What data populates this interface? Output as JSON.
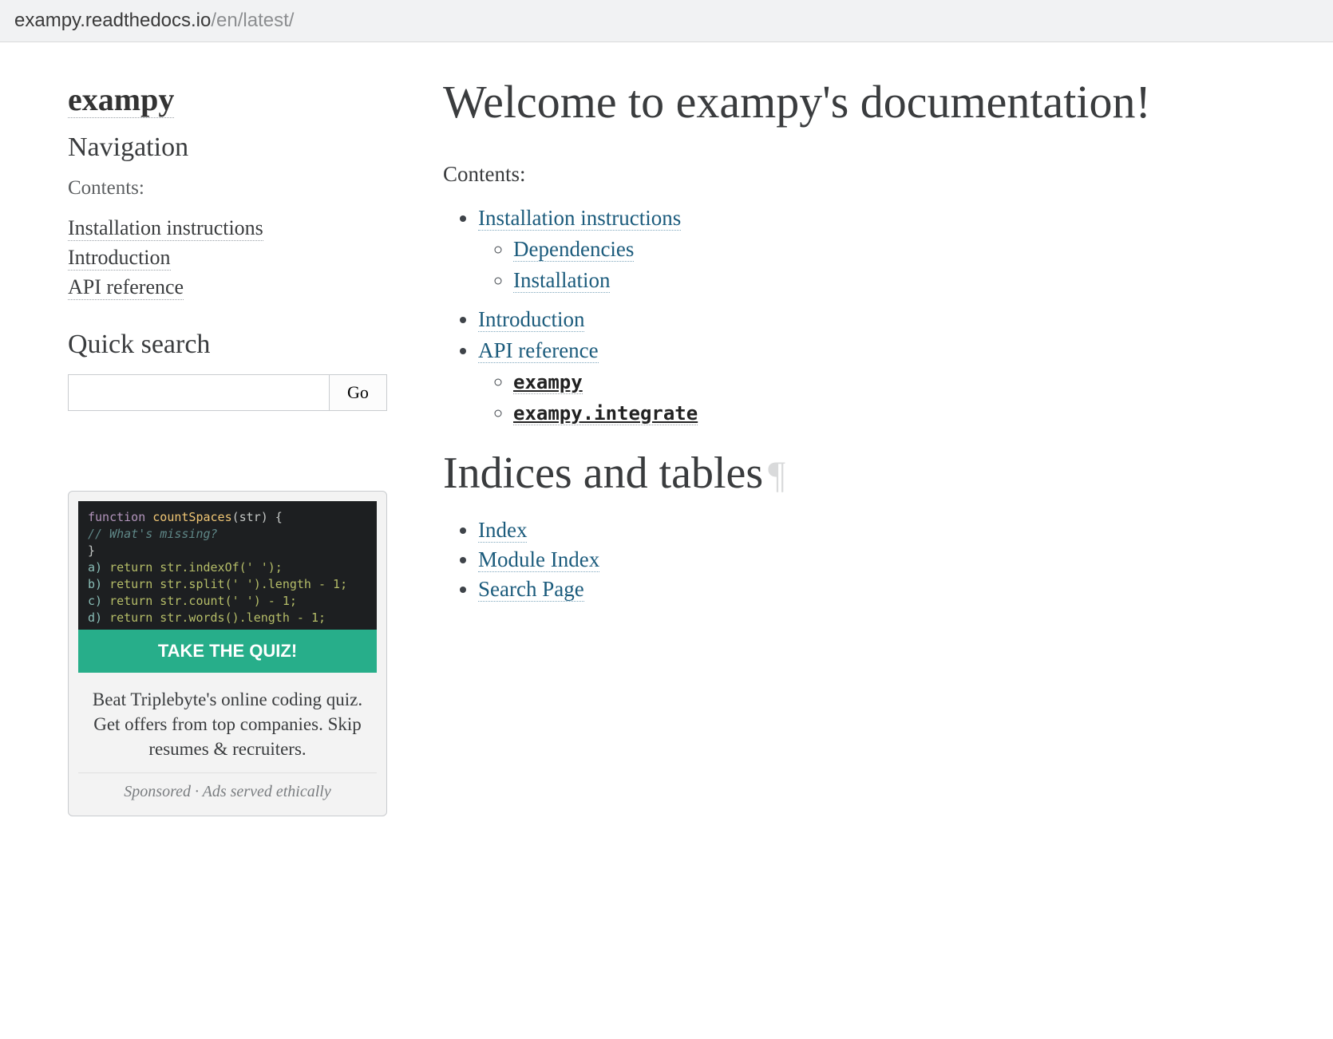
{
  "url": {
    "host": "exampy.readthedocs.io",
    "path": "/en/latest/"
  },
  "sidebar": {
    "site_title": "exampy",
    "nav_heading": "Navigation",
    "contents_label": "Contents:",
    "nav": [
      "Installation instructions",
      "Introduction",
      "API reference"
    ],
    "search_heading": "Quick search",
    "search_placeholder": "",
    "search_button": "Go"
  },
  "ad": {
    "code_lines": {
      "l1_kw": "function",
      "l1_fn": " countSpaces",
      "l1_rest": "(str) {",
      "l2": "  // What's missing?",
      "l3": "}",
      "opt_a": "a) ",
      "opt_a_code": "return str.indexOf(' ');",
      "opt_b": "b) ",
      "opt_b_code": "return str.split(' ').length - 1;",
      "opt_c": "c) ",
      "opt_c_code": "return str.count(' ') - 1;",
      "opt_d": "d) ",
      "opt_d_code": "return str.words().length - 1;"
    },
    "cta": "TAKE THE QUIZ!",
    "text": "Beat Triplebyte's online coding quiz. Get offers from top companies. Skip resumes & recruiters.",
    "footer": "Sponsored · Ads served ethically"
  },
  "main": {
    "title": "Welcome to exampy's documentation!",
    "contents_label": "Contents:",
    "toc": [
      {
        "label": "Installation instructions",
        "children": [
          {
            "label": "Dependencies"
          },
          {
            "label": "Installation"
          }
        ]
      },
      {
        "label": "Introduction"
      },
      {
        "label": "API reference",
        "children": [
          {
            "label": "exampy",
            "code": true
          },
          {
            "label": "exampy.integrate",
            "code": true
          }
        ]
      }
    ],
    "indices_heading": "Indices and tables",
    "pilcrow": "¶",
    "indices": [
      "Index",
      "Module Index",
      "Search Page"
    ]
  }
}
